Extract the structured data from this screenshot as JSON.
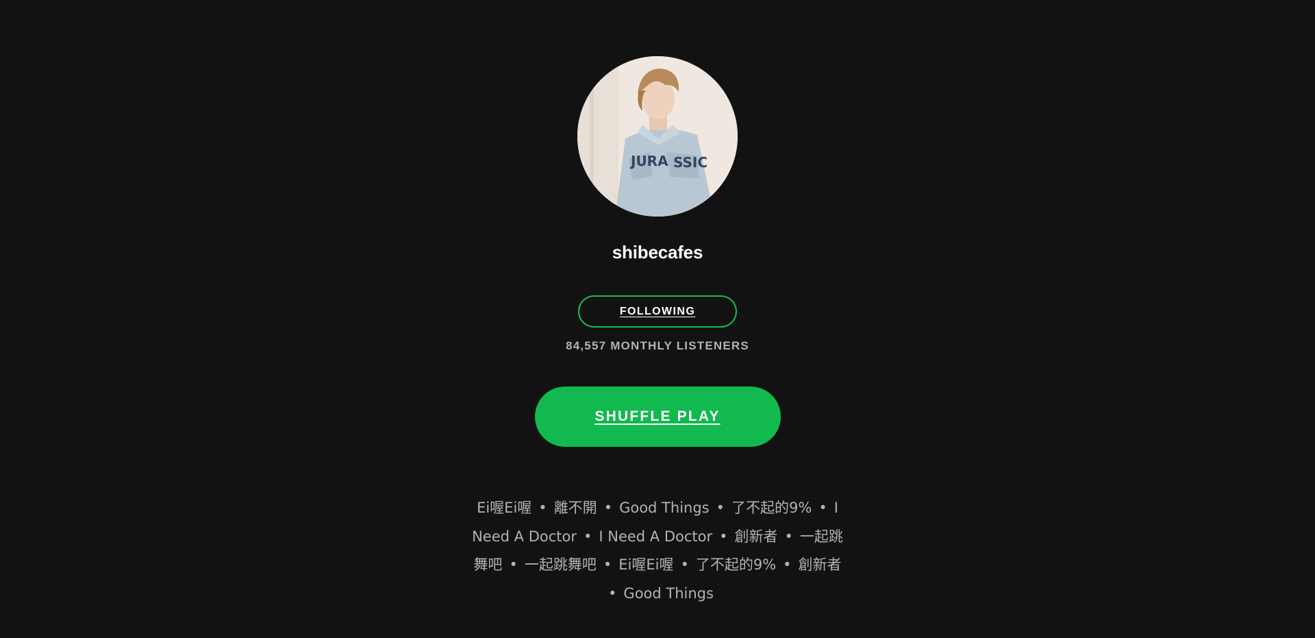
{
  "artist": {
    "name": "shibecafes",
    "avatar_alt": "artist avatar"
  },
  "follow_button": {
    "label": "FOLLOWING"
  },
  "stats": {
    "monthly_listeners": "84,557 MONTHLY LISTENERS"
  },
  "shuffle_button": {
    "label": "SHUFFLE PLAY"
  },
  "tracks": [
    "Ei喔Ei喔",
    "離不開",
    "Good Things",
    "了不起的9%",
    "I Need A Doctor",
    "I Need A Doctor",
    "創新者",
    "一起跳舞吧",
    "一起跳舞吧",
    "Ei喔Ei喔",
    "了不起的9%",
    "創新者",
    "Good Things"
  ],
  "separator": "•",
  "colors": {
    "background": "#121212",
    "accent": "#1db954",
    "text_primary": "#ffffff",
    "text_secondary": "#b3b3b3"
  }
}
